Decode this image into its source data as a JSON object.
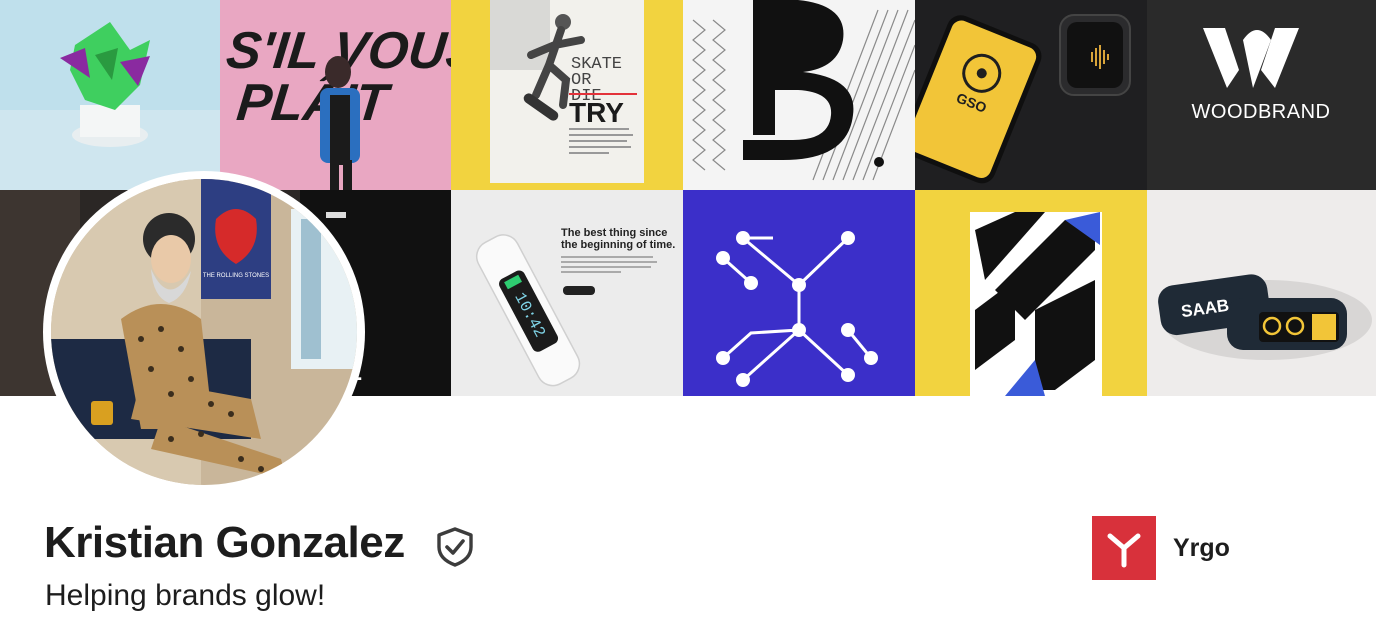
{
  "profile": {
    "name": "Kristian Gonzalez",
    "headline": "Helping brands glow!"
  },
  "company": {
    "name": "Yrgo"
  },
  "banner": {
    "tiles": {
      "silvousplait_line1": "S'IL VOUS",
      "silvousplait_line2": "PLÂIT",
      "skate_line1": "SKATE",
      "skate_line2": "OR",
      "skate_line3": "DIE",
      "skate_line4": "TRY",
      "phone_label": "GSO",
      "woodbrand_label": "WOODBRAND",
      "poster_stones": "THE ROLLING STONES",
      "device_time": "10:42",
      "device_heading_1": "The best thing since",
      "device_heading_2": "the beginning of time.",
      "saab_label": "SAAB"
    }
  }
}
